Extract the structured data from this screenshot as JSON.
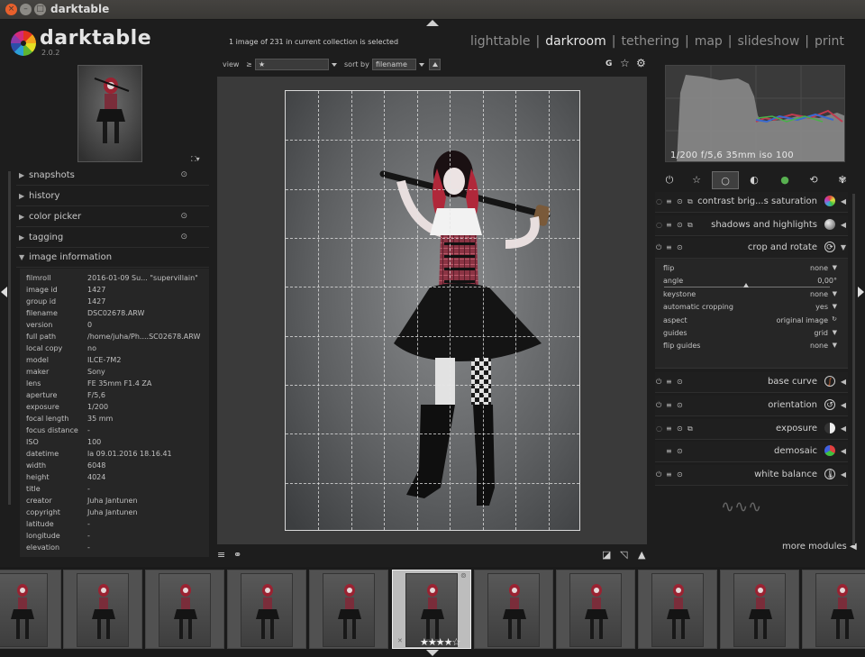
{
  "window": {
    "title": "darktable"
  },
  "logo": {
    "name": "darktable",
    "version": "2.0.2"
  },
  "header": {
    "collection_info": "1 image of 231 in current collection is selected",
    "views": [
      {
        "label": "lighttable",
        "active": false
      },
      {
        "label": "darkroom",
        "active": true
      },
      {
        "label": "tethering",
        "active": false
      },
      {
        "label": "map",
        "active": false
      },
      {
        "label": "slideshow",
        "active": false
      },
      {
        "label": "print",
        "active": false
      }
    ],
    "view_label": "view",
    "view_operator": "≥",
    "view_value": "★",
    "sort_label": "sort by",
    "sort_value": "filename",
    "g_label": "G"
  },
  "left_panel": {
    "sections": [
      {
        "label": "snapshots",
        "expanded": false
      },
      {
        "label": "history",
        "expanded": false
      },
      {
        "label": "color picker",
        "expanded": false
      },
      {
        "label": "tagging",
        "expanded": false
      },
      {
        "label": "image information",
        "expanded": true
      }
    ],
    "image_info": [
      {
        "key": "filmroll",
        "value": "2016-01-09 Su... \"supervillain\""
      },
      {
        "key": "image id",
        "value": "1427"
      },
      {
        "key": "group id",
        "value": "1427"
      },
      {
        "key": "filename",
        "value": "DSC02678.ARW"
      },
      {
        "key": "version",
        "value": "0"
      },
      {
        "key": "full path",
        "value": "/home/juha/Ph....SC02678.ARW"
      },
      {
        "key": "local copy",
        "value": "no"
      },
      {
        "key": "model",
        "value": "ILCE-7M2"
      },
      {
        "key": "maker",
        "value": "Sony"
      },
      {
        "key": "lens",
        "value": "FE 35mm F1.4 ZA"
      },
      {
        "key": "aperture",
        "value": "F/5,6"
      },
      {
        "key": "exposure",
        "value": "1/200"
      },
      {
        "key": "focal length",
        "value": "35 mm"
      },
      {
        "key": "focus distance",
        "value": "-"
      },
      {
        "key": "ISO",
        "value": "100"
      },
      {
        "key": "datetime",
        "value": "la 09.01.2016 18.16.41"
      },
      {
        "key": "width",
        "value": "6048"
      },
      {
        "key": "height",
        "value": "4024"
      },
      {
        "key": "title",
        "value": "-"
      },
      {
        "key": "creator",
        "value": "Juha Jantunen"
      },
      {
        "key": "copyright",
        "value": "Juha Jantunen"
      },
      {
        "key": "latitude",
        "value": "-"
      },
      {
        "key": "longitude",
        "value": "-"
      },
      {
        "key": "elevation",
        "value": "-"
      }
    ]
  },
  "histogram": {
    "info": "1/200 f/5,6 35mm iso 100"
  },
  "right_panel": {
    "modules": [
      {
        "name": "contrast brig...s saturation",
        "icon": "color-wheel-icon"
      },
      {
        "name": "shadows and highlights",
        "icon": "sphere-icon"
      },
      {
        "name": "crop and rotate",
        "icon": "crop-rotate-icon",
        "expanded": true
      },
      {
        "name": "base curve",
        "icon": "curve-icon"
      },
      {
        "name": "orientation",
        "icon": "rotate-icon"
      },
      {
        "name": "exposure",
        "icon": "exposure-icon"
      },
      {
        "name": "demosaic",
        "icon": "rgb-dots-icon"
      },
      {
        "name": "white balance",
        "icon": "wb-icon"
      }
    ],
    "crop_params": [
      {
        "key": "flip",
        "value": "none"
      },
      {
        "key": "angle",
        "value": "0,00°"
      },
      {
        "key": "keystone",
        "value": "none"
      },
      {
        "key": "automatic cropping",
        "value": "yes"
      },
      {
        "key": "aspect",
        "value": "original image"
      },
      {
        "key": "guides",
        "value": "grid"
      },
      {
        "key": "flip guides",
        "value": "none"
      }
    ],
    "more_modules": "more modules"
  },
  "filmstrip": {
    "count": 11,
    "selected_index": 5,
    "stars": "★★★★☆"
  },
  "colors": {
    "accent": "#e8e8e8",
    "bg": "#1d1d1d",
    "panel": "#262626"
  }
}
